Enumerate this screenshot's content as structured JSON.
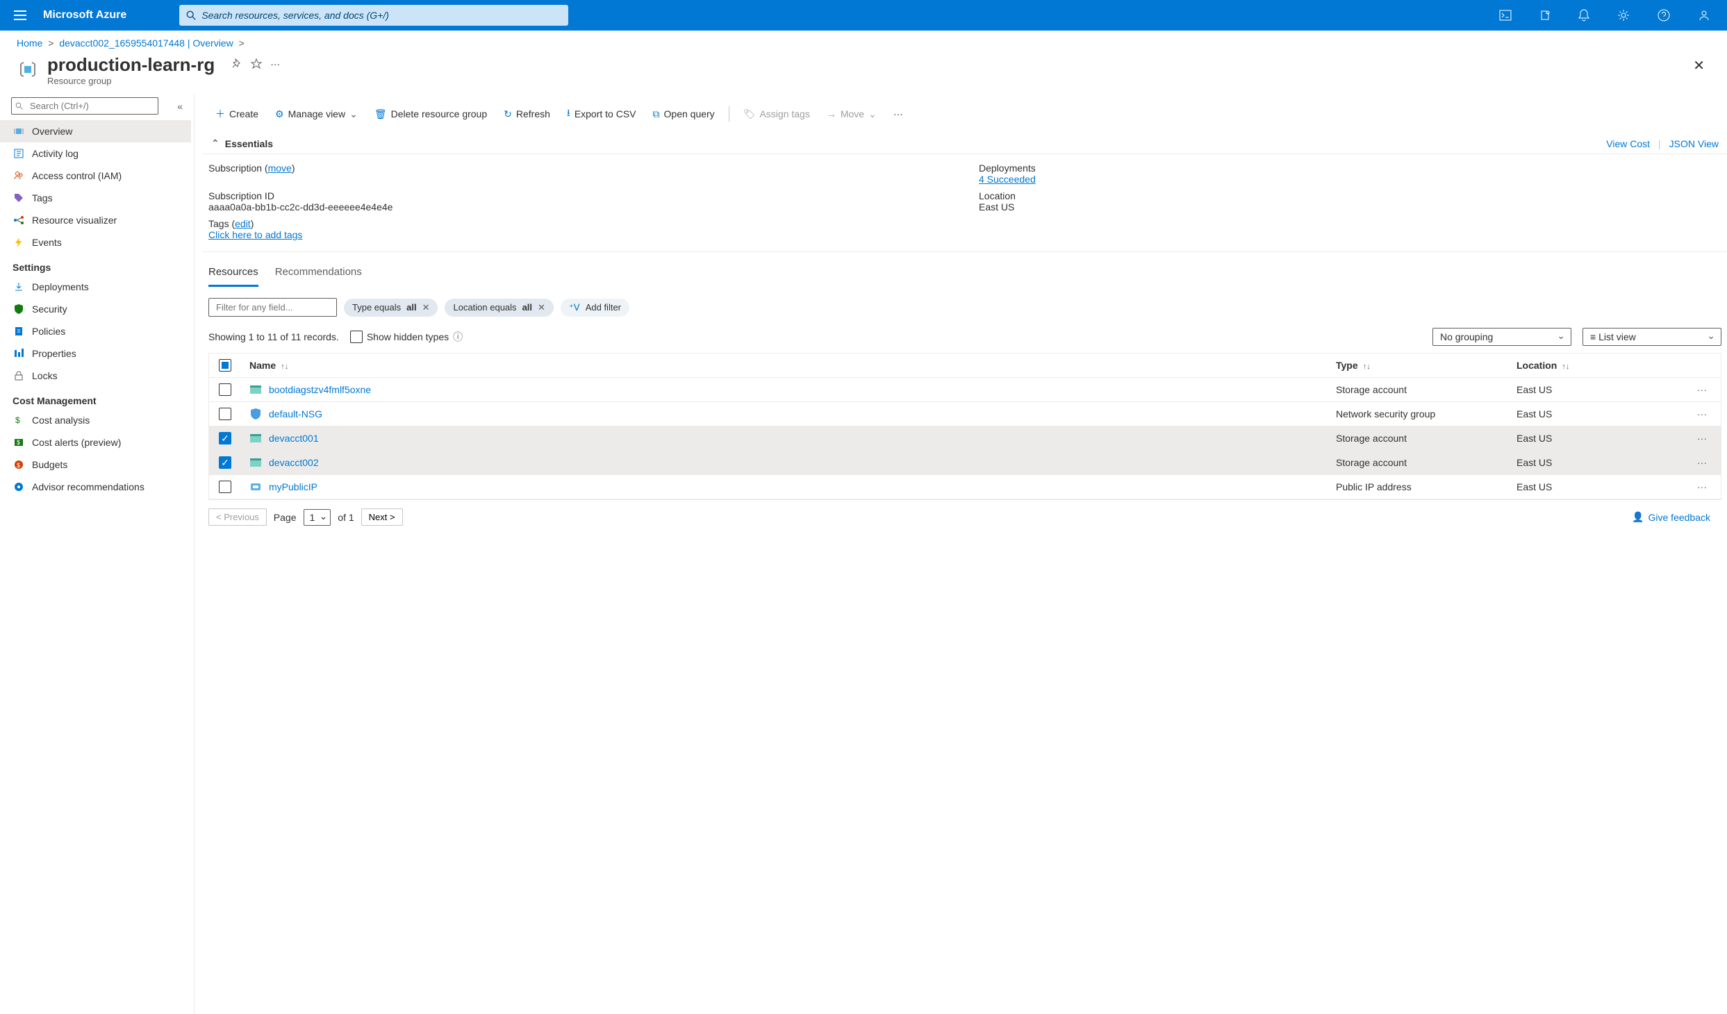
{
  "topbar": {
    "brand": "Microsoft Azure",
    "search_placeholder": "Search resources, services, and docs (G+/)"
  },
  "breadcrumb": {
    "home": "Home",
    "path": "devacct002_1659554017448 | Overview"
  },
  "header": {
    "title": "production-learn-rg",
    "subtitle": "Resource group"
  },
  "sidebar": {
    "search_placeholder": "Search (Ctrl+/)",
    "items": {
      "overview": "Overview",
      "activity": "Activity log",
      "iam": "Access control (IAM)",
      "tags": "Tags",
      "visualizer": "Resource visualizer",
      "events": "Events"
    },
    "sections": {
      "settings": "Settings",
      "cost": "Cost Management"
    },
    "settings_items": {
      "deployments": "Deployments",
      "security": "Security",
      "policies": "Policies",
      "properties": "Properties",
      "locks": "Locks"
    },
    "cost_items": {
      "analysis": "Cost analysis",
      "alerts": "Cost alerts (preview)",
      "budgets": "Budgets",
      "advisor": "Advisor recommendations"
    }
  },
  "toolbar": {
    "create": "Create",
    "manage_view": "Manage view",
    "delete": "Delete resource group",
    "refresh": "Refresh",
    "export": "Export to CSV",
    "open_query": "Open query",
    "assign_tags": "Assign tags",
    "move": "Move"
  },
  "essentials": {
    "label": "Essentials",
    "view_cost": "View Cost",
    "json_view": "JSON View",
    "subscription_label": "Subscription (",
    "move_link": "move",
    "subid_label": "Subscription ID",
    "subid_value": "aaaa0a0a-bb1b-cc2c-dd3d-eeeeee4e4e4e",
    "tags_label": "Tags (",
    "edit_link": "edit",
    "tags_link": "Click here to add tags",
    "deployments_label": "Deployments",
    "deployments_value": "4 Succeeded",
    "location_label": "Location",
    "location_value": "East US"
  },
  "tabs": {
    "resources": "Resources",
    "recommendations": "Recommendations"
  },
  "filters": {
    "input_placeholder": "Filter for any field...",
    "type_pill_prefix": "Type equals ",
    "type_pill_value": "all",
    "loc_pill_prefix": "Location equals ",
    "loc_pill_value": "all",
    "add_filter": "Add filter"
  },
  "records": {
    "showing": "Showing 1 to 11 of 11 records.",
    "hidden": "Show hidden types",
    "no_grouping": "No grouping",
    "list_view": "List view"
  },
  "columns": {
    "name": "Name",
    "type": "Type",
    "location": "Location"
  },
  "rows": [
    {
      "name": "bootdiagstzv4fmlf5oxne",
      "type": "Storage account",
      "location": "East US",
      "selected": false,
      "icon": "storage"
    },
    {
      "name": "default-NSG",
      "type": "Network security group",
      "location": "East US",
      "selected": false,
      "icon": "nsg"
    },
    {
      "name": "devacct001",
      "type": "Storage account",
      "location": "East US",
      "selected": true,
      "icon": "storage"
    },
    {
      "name": "devacct002",
      "type": "Storage account",
      "location": "East US",
      "selected": true,
      "icon": "storage"
    },
    {
      "name": "myPublicIP",
      "type": "Public IP address",
      "location": "East US",
      "selected": false,
      "icon": "ip"
    }
  ],
  "pager": {
    "prev": "< Previous",
    "page_label": "Page",
    "page_value": "1",
    "of_label": "of 1",
    "next": "Next >",
    "feedback": "Give feedback"
  }
}
